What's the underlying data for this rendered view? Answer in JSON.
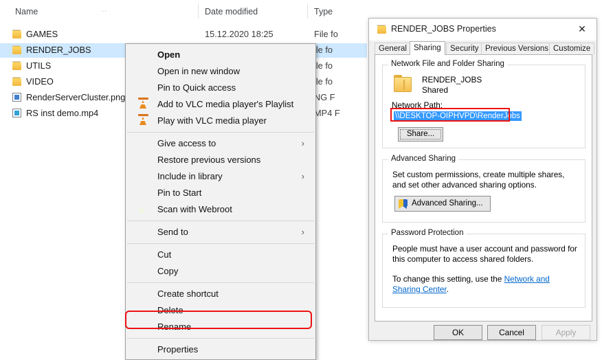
{
  "explorer": {
    "columns": [
      {
        "label": "Name"
      },
      {
        "label": "Date modified"
      },
      {
        "label": "Type"
      }
    ],
    "rows": [
      {
        "name": "GAMES",
        "date": "15.12.2020 18:25",
        "type": "File fo",
        "icon": "folder-icon",
        "selected": false
      },
      {
        "name": "RENDER_JOBS",
        "date": "",
        "type": "ile fo",
        "icon": "folder-icon",
        "selected": true
      },
      {
        "name": "UTILS",
        "date": "",
        "type": "ile fo",
        "icon": "folder-icon",
        "selected": false
      },
      {
        "name": "VIDEO",
        "date": "",
        "type": "ile fo",
        "icon": "folder-icon",
        "selected": false
      },
      {
        "name": "RenderServerCluster.png",
        "date": "",
        "type": "NG F",
        "icon": "png-file-icon",
        "selected": false
      },
      {
        "name": "RS inst demo.mp4",
        "date": "",
        "type": "MP4 F",
        "icon": "mp4-file-icon",
        "selected": false
      }
    ]
  },
  "context_menu": {
    "items": [
      {
        "label": "Open",
        "bold": true,
        "icon": null,
        "submenu": false,
        "separator_after": false
      },
      {
        "label": "Open in new window",
        "bold": false,
        "icon": null,
        "submenu": false,
        "separator_after": false
      },
      {
        "label": "Pin to Quick access",
        "bold": false,
        "icon": null,
        "submenu": false,
        "separator_after": false
      },
      {
        "label": "Add to VLC media player's Playlist",
        "bold": false,
        "icon": "vlc-icon",
        "submenu": false,
        "separator_after": false
      },
      {
        "label": "Play with VLC media player",
        "bold": false,
        "icon": "vlc-icon",
        "submenu": false,
        "separator_after": true
      },
      {
        "label": "Give access to",
        "bold": false,
        "icon": null,
        "submenu": true,
        "separator_after": false
      },
      {
        "label": "Restore previous versions",
        "bold": false,
        "icon": null,
        "submenu": false,
        "separator_after": false
      },
      {
        "label": "Include in library",
        "bold": false,
        "icon": null,
        "submenu": true,
        "separator_after": false
      },
      {
        "label": "Pin to Start",
        "bold": false,
        "icon": null,
        "submenu": false,
        "separator_after": false
      },
      {
        "label": "Scan with Webroot",
        "bold": false,
        "icon": "webroot-icon",
        "submenu": false,
        "separator_after": true
      },
      {
        "label": "Send to",
        "bold": false,
        "icon": null,
        "submenu": true,
        "separator_after": true
      },
      {
        "label": "Cut",
        "bold": false,
        "icon": null,
        "submenu": false,
        "separator_after": false
      },
      {
        "label": "Copy",
        "bold": false,
        "icon": null,
        "submenu": false,
        "separator_after": true
      },
      {
        "label": "Create shortcut",
        "bold": false,
        "icon": null,
        "submenu": false,
        "separator_after": false
      },
      {
        "label": "Delete",
        "bold": false,
        "icon": null,
        "submenu": false,
        "separator_after": false
      },
      {
        "label": "Rename",
        "bold": false,
        "icon": null,
        "submenu": false,
        "separator_after": true
      },
      {
        "label": "Properties",
        "bold": false,
        "icon": null,
        "submenu": false,
        "separator_after": false
      }
    ],
    "submenu_chevron": "›"
  },
  "dialog": {
    "title": "RENDER_JOBS Properties",
    "close_label": "✕",
    "tabs": [
      {
        "label": "General",
        "active": false
      },
      {
        "label": "Sharing",
        "active": true
      },
      {
        "label": "Security",
        "active": false
      },
      {
        "label": "Previous Versions",
        "active": false
      },
      {
        "label": "Customize",
        "active": false
      }
    ],
    "network_group": {
      "legend": "Network File and Folder Sharing",
      "share_name": "RENDER_JOBS",
      "share_state": "Shared",
      "path_label": "Network Path:",
      "path_value": "\\\\DESKTOP-OIPHVPD\\RenderJobs",
      "share_button": "Share..."
    },
    "advanced_group": {
      "legend": "Advanced Sharing",
      "description": "Set custom permissions, create multiple shares, and set other advanced sharing options.",
      "button": "Advanced Sharing..."
    },
    "password_group": {
      "legend": "Password Protection",
      "line1": "People must have a user account and password for this computer to access shared folders.",
      "line2_prefix": "To change this setting, use the ",
      "link": "Network and Sharing Center",
      "line2_suffix": "."
    },
    "buttons": {
      "ok": "OK",
      "cancel": "Cancel",
      "apply": "Apply"
    }
  },
  "annotations": {
    "highlight_color": "#ee1111",
    "selection_color": "#3399ff",
    "row_selection_color": "#cde8ff"
  }
}
